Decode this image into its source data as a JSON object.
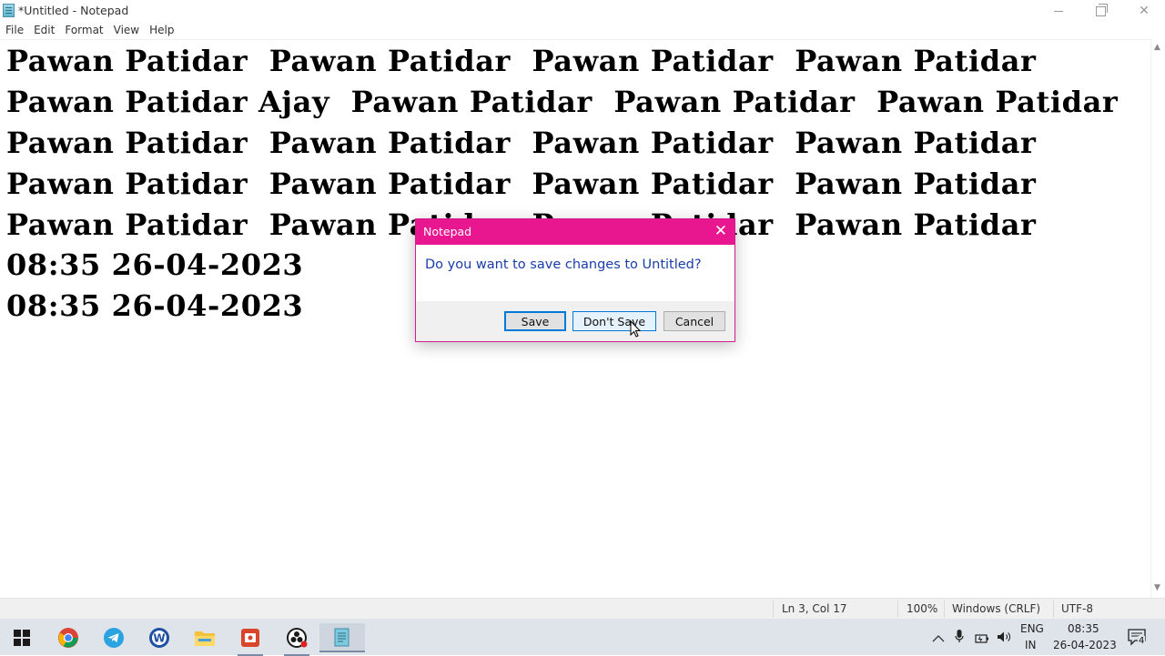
{
  "window": {
    "title": "*Untitled - Notepad"
  },
  "menu": [
    "File",
    "Edit",
    "Format",
    "View",
    "Help"
  ],
  "editor": {
    "lines": [
      "Pawan Patidar  Pawan Patidar  Pawan Patidar  Pawan Patidar",
      "Pawan Patidar Ajay  Pawan Patidar  Pawan Patidar  Pawan Patidar",
      "Pawan Patidar  Pawan Patidar  Pawan Patidar  Pawan Patidar",
      "Pawan Patidar  Pawan Patidar  Pawan Patidar  Pawan Patidar",
      "Pawan Patidar  Pawan Patidar  Pawan Patidar  Pawan Patidar",
      "08:35 26-04-2023",
      "08:35 26-04-2023"
    ]
  },
  "status": {
    "position": "Ln 3, Col 17",
    "zoom": "100%",
    "line_endings": "Windows (CRLF)",
    "encoding": "UTF-8"
  },
  "dialog": {
    "title": "Notepad",
    "close_glyph": "✕",
    "message": "Do you want to save changes to Untitled?",
    "save_label": "Save",
    "dont_save_label": "Don't Save",
    "cancel_label": "Cancel"
  },
  "taskbar": {
    "apps": [
      "windows-start-icon",
      "chrome-icon",
      "telegram-icon",
      "word-icon",
      "file-explorer-icon",
      "screen-recorder-icon",
      "obs-icon",
      "notepad-icon"
    ],
    "tray": {
      "language_top": "ENG",
      "language_bottom": "IN",
      "time": "08:35",
      "date": "26-04-2023",
      "notification_count": "4"
    }
  },
  "colors": {
    "dialog_accent": "#e8168f",
    "focus_blue": "#0078d7"
  }
}
